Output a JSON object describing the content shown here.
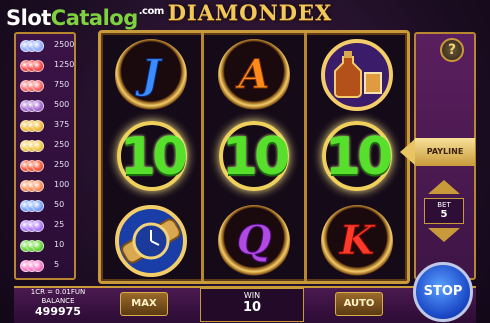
{
  "header": {
    "watermark_logo": "SlotCatalog.com",
    "game_title": "DIAMONDEX"
  },
  "paytable": [
    {
      "value": "2500",
      "colors": [
        "#9fb7ff",
        "#6f8fe8"
      ]
    },
    {
      "value": "1250",
      "colors": [
        "#ff5a5a",
        "#c82020"
      ]
    },
    {
      "value": "750",
      "colors": [
        "#ff7a7a",
        "#c83030"
      ]
    },
    {
      "value": "500",
      "colors": [
        "#b07ad8",
        "#7c3aa8"
      ]
    },
    {
      "value": "375",
      "colors": [
        "#f6c24a",
        "#c89020"
      ]
    },
    {
      "value": "250",
      "colors": [
        "#f6d05a",
        "#d09a20"
      ]
    },
    {
      "value": "250",
      "colors": [
        "#ff6a4a",
        "#c83a20"
      ]
    },
    {
      "value": "100",
      "colors": [
        "#ff9a6a",
        "#d06030"
      ]
    },
    {
      "value": "50",
      "colors": [
        "#8ab0ff",
        "#4a70d8"
      ]
    },
    {
      "value": "25",
      "colors": [
        "#b88aff",
        "#7a4ad8"
      ]
    },
    {
      "value": "10",
      "colors": [
        "#7ae04a",
        "#3ea020"
      ]
    },
    {
      "value": "5",
      "colors": [
        "#ff8ad0",
        "#c84a98"
      ]
    }
  ],
  "reels": {
    "reel1": [
      "J",
      "10",
      "watch"
    ],
    "reel2": [
      "A",
      "10",
      "Q"
    ],
    "reel3": [
      "cognac",
      "10",
      "K"
    ]
  },
  "symbol_colors": {
    "J": "#3a8cff",
    "A": "#ff8a1a",
    "Q": "#b04ae0",
    "K": "#ff3a2a"
  },
  "controls": {
    "help": "?",
    "payline": "PAYLINE",
    "bet_label": "BET",
    "bet_value": "5",
    "cr_rate": "1CR = 0.01FUN",
    "balance_label": "BALANCE",
    "balance_value": "499975",
    "max": "MAX",
    "win_label": "WIN",
    "win_value": "10",
    "auto": "AUTO",
    "stop": "STOP"
  },
  "colors": {
    "accent_gold": "#c99a3a",
    "win_green": "#56e02c",
    "stop_blue": "#1c4ac8"
  }
}
